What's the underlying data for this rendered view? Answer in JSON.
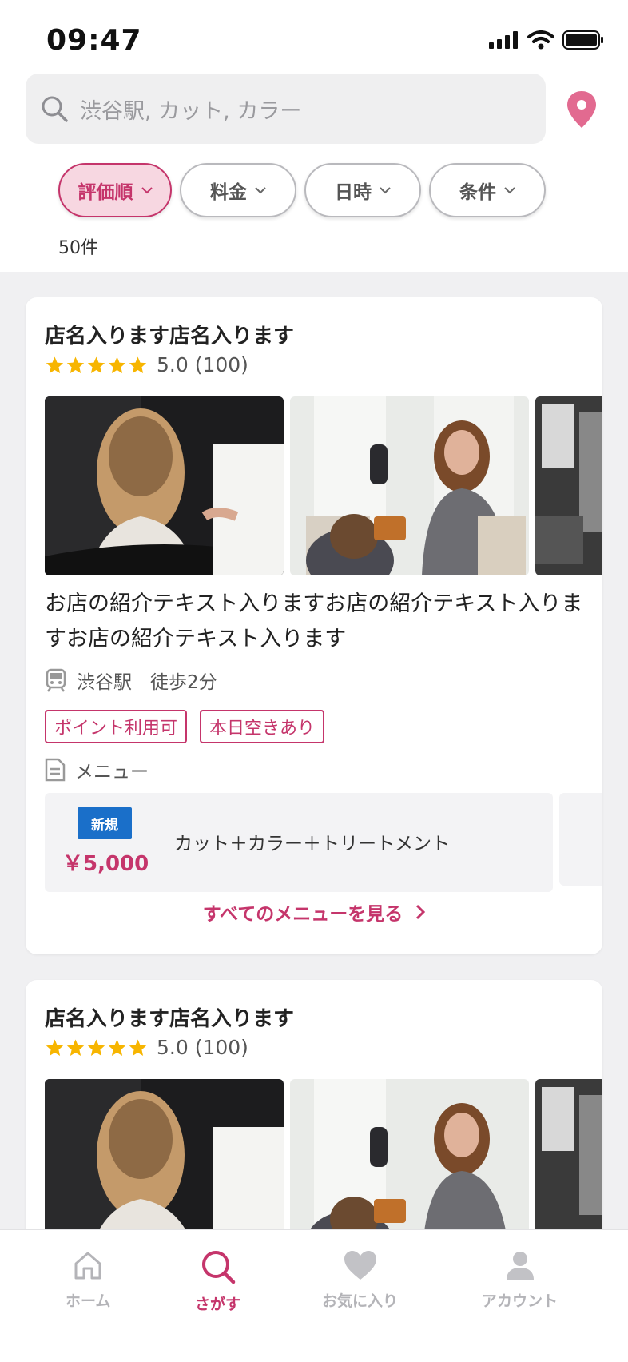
{
  "status_bar": {
    "time": "09:47"
  },
  "search": {
    "placeholder": "渋谷駅, カット, カラー"
  },
  "filters": [
    {
      "label": "評価順",
      "active": true
    },
    {
      "label": "料金",
      "active": false
    },
    {
      "label": "日時",
      "active": false
    },
    {
      "label": "条件",
      "active": false
    }
  ],
  "result_count": "50件",
  "shops": [
    {
      "name": "店名入ります店名入ります",
      "rating": "5.0 (100)",
      "intro": "お店の紹介テキスト入りますお店の紹介テキスト入りますお店の紹介テキスト入ります",
      "station": "渋谷駅　徒歩2分",
      "tags": [
        "ポイント利用可",
        "本日空きあり"
      ],
      "menu_label": "メニュー",
      "menu": {
        "badge": "新規",
        "price": "￥5,000",
        "name": "カット＋カラー＋トリートメント"
      },
      "see_all": "すべてのメニューを見る"
    },
    {
      "name": "店名入ります店名入ります",
      "rating": "5.0 (100)"
    }
  ],
  "tabbar": [
    {
      "label": "ホーム",
      "icon": "home-icon",
      "active": false
    },
    {
      "label": "さがす",
      "icon": "search-icon",
      "active": true
    },
    {
      "label": "お気に入り",
      "icon": "heart-icon",
      "active": false
    },
    {
      "label": "アカウント",
      "icon": "person-icon",
      "active": false
    }
  ],
  "colors": {
    "accent": "#c5356b",
    "badge_blue": "#1a6fc9",
    "star": "#f7b500"
  }
}
